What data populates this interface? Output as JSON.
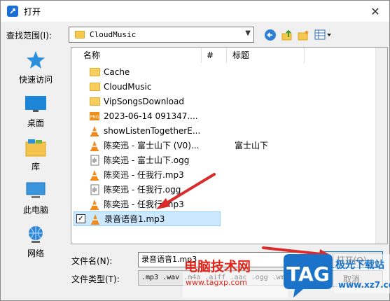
{
  "window": {
    "title": "打开"
  },
  "lookin": {
    "label": "查找范围(I):",
    "value": "CloudMusic"
  },
  "places": [
    {
      "label": "快速访问",
      "icon": "star-icon"
    },
    {
      "label": "桌面",
      "icon": "desktop-icon"
    },
    {
      "label": "库",
      "icon": "library-icon"
    },
    {
      "label": "此电脑",
      "icon": "computer-icon"
    },
    {
      "label": "网络",
      "icon": "network-icon"
    }
  ],
  "columns": {
    "name": "名称",
    "number": "#",
    "title": "标题"
  },
  "files": [
    {
      "name": "Cache",
      "type": "folder",
      "title": ""
    },
    {
      "name": "CloudMusic",
      "type": "folder",
      "title": ""
    },
    {
      "name": "VipSongsDownload",
      "type": "folder",
      "title": ""
    },
    {
      "name": "2023-06-14 091347....",
      "type": "image",
      "title": ""
    },
    {
      "name": "showListenTogetherE...",
      "type": "vlc",
      "title": ""
    },
    {
      "name": "陈奕迅 - 富士山下 (V0)...",
      "type": "vlc",
      "title": "富士山下"
    },
    {
      "name": "陈奕迅 - 富士山下.ogg",
      "type": "audio",
      "title": ""
    },
    {
      "name": "陈奕迅 - 任我行.mp3",
      "type": "vlc",
      "title": ""
    },
    {
      "name": "陈奕迅 - 任我行.ogg",
      "type": "audio",
      "title": ""
    },
    {
      "name": "陈奕迅 - 任我行.mp3",
      "type": "vlc",
      "title": ""
    },
    {
      "name": "录音语音1.mp3",
      "type": "vlc",
      "title": "",
      "selected": true
    }
  ],
  "filename": {
    "label": "文件名(N):",
    "value": "录音语音1.mp3"
  },
  "filetype": {
    "label": "文件类型(T):",
    "value": ".mp3 .wav .m4a .aiff .aac .ogg .wma"
  },
  "buttons": {
    "open": "打开(O)",
    "cancel": "取消"
  },
  "watermark": {
    "site_name": "电脑技术网",
    "url": "www.tagxp.com",
    "logo_text": "TAG",
    "right_top": "极光下载站",
    "right_url": "www.xz7.com"
  },
  "colors": {
    "accent": "#0078d7",
    "selection": "#cce8ff",
    "folder": "#f7cd5d",
    "arrow": "#d92b2b",
    "watermark_red": "#e3261c",
    "watermark_blue": "#1a73c9"
  }
}
